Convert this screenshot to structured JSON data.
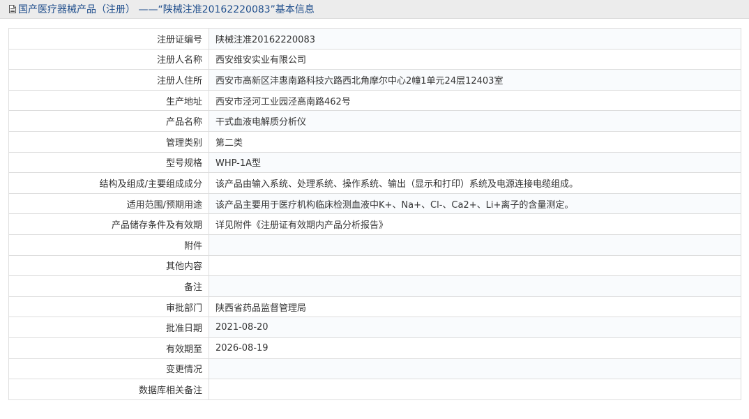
{
  "header": {
    "icon": "document-icon",
    "title": "国产医疗器械产品（注册） ——“陕械注准20162220083”基本信息"
  },
  "rows": [
    {
      "label": "注册证编号",
      "value": "陕械注准20162220083"
    },
    {
      "label": "注册人名称",
      "value": "西安维安实业有限公司"
    },
    {
      "label": "注册人住所",
      "value": "西安市高新区沣惠南路科技六路西北角摩尔中心2幢1单元24层12403室"
    },
    {
      "label": "生产地址",
      "value": "西安市泾河工业园泾高南路462号"
    },
    {
      "label": "产品名称",
      "value": "干式血液电解质分析仪"
    },
    {
      "label": "管理类别",
      "value": "第二类"
    },
    {
      "label": "型号规格",
      "value": "WHP-1A型"
    },
    {
      "label": "结构及组成/主要组成成分",
      "value": "该产品由输入系统、处理系统、操作系统、输出（显示和打印）系统及电源连接电缆组成。"
    },
    {
      "label": "适用范围/预期用途",
      "value": "该产品主要用于医疗机构临床检测血液中K+、Na+、Cl-、Ca2+、Li+离子的含量测定。"
    },
    {
      "label": "产品储存条件及有效期",
      "value": "详见附件《注册证有效期内产品分析报告》"
    },
    {
      "label": "附件",
      "value": ""
    },
    {
      "label": "其他内容",
      "value": ""
    },
    {
      "label": "备注",
      "value": ""
    },
    {
      "label": "审批部门",
      "value": "陕西省药品监督管理局"
    },
    {
      "label": "批准日期",
      "value": "2021-08-20"
    },
    {
      "label": "有效期至",
      "value": "2026-08-19"
    },
    {
      "label": "变更情况",
      "value": ""
    },
    {
      "label": "数据库相关备注",
      "value": ""
    }
  ]
}
